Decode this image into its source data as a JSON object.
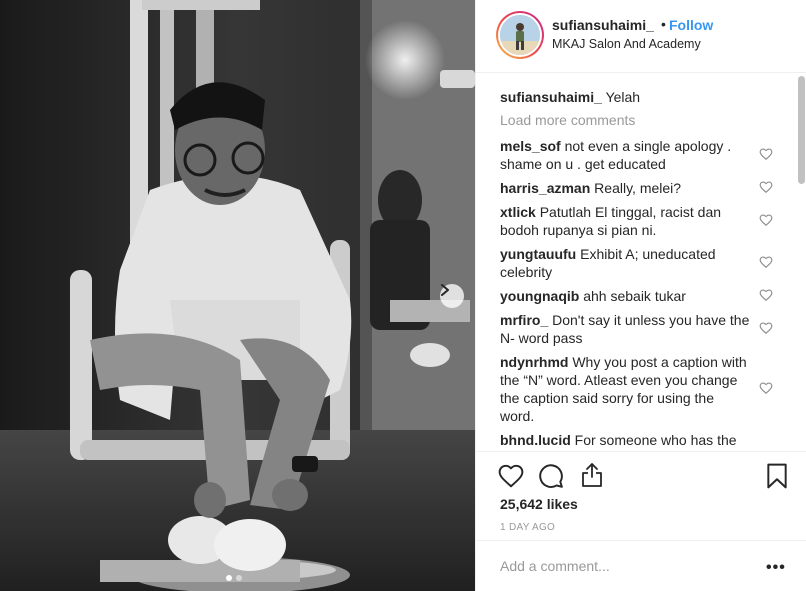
{
  "post": {
    "image_alt": "photo",
    "carousel_dots": 2,
    "active_dot": 0
  },
  "header": {
    "username": "sufiansuhaimi_",
    "separator": "•",
    "follow_label": "Follow",
    "location": "MKAJ Salon And Academy"
  },
  "caption": {
    "username": "sufiansuhaimi_",
    "text": "Yelah"
  },
  "load_more_label": "Load more comments",
  "comments": [
    {
      "username": "mels_sof",
      "text": "not even a single apology . shame on u . get educated"
    },
    {
      "username": "harris_azman",
      "text": "Really, melei?"
    },
    {
      "username": "xtlick",
      "text": "Patutlah El tinggal, racist dan bodoh rupanya si pian ni."
    },
    {
      "username": "yungtauufu",
      "text": "Exhibit A; uneducated celebrity"
    },
    {
      "username": "youngnaqib",
      "text": "ahh sebaik tukar"
    },
    {
      "username": "mrfiro_",
      "text": "Don't say it unless you have the N- word pass"
    },
    {
      "username": "ndynrhmd",
      "text": "Why you post a caption with the “N” word. Atleast even you change the caption said sorry for using the word."
    },
    {
      "username": "bhnd.lucid",
      "text": "For someone who has the"
    }
  ],
  "likes": "25,642 likes",
  "time_ago": "1 DAY AGO",
  "add_comment_placeholder": "Add a comment...",
  "more_label": "•••",
  "colors": {
    "accent": "#3897f0",
    "text": "#262626",
    "muted": "#999999",
    "border": "#efefef"
  },
  "icons": [
    "chevron-right-icon",
    "heart-icon",
    "comment-icon",
    "share-icon",
    "bookmark-icon",
    "more-icon"
  ]
}
